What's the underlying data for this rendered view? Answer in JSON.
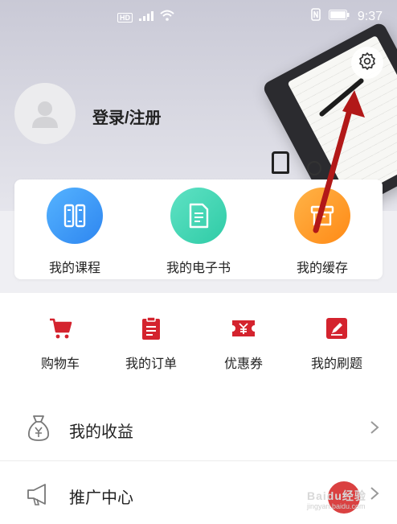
{
  "status_bar": {
    "network_badge": "HD",
    "time": "9:37",
    "icons": [
      "signal-icon",
      "wifi-icon",
      "nfc-icon",
      "battery-icon"
    ]
  },
  "profile": {
    "login_label": "登录/注册"
  },
  "card_items": [
    {
      "label": "我的课程",
      "icon": "books-icon",
      "color": "#3a96f5"
    },
    {
      "label": "我的电子书",
      "icon": "ebook-icon",
      "color": "#3dd4b1"
    },
    {
      "label": "我的缓存",
      "icon": "download-box-icon",
      "color": "#ff9a26"
    }
  ],
  "shortcuts": [
    {
      "label": "购物车",
      "icon": "cart-icon"
    },
    {
      "label": "我的订单",
      "icon": "order-icon"
    },
    {
      "label": "优惠券",
      "icon": "coupon-icon"
    },
    {
      "label": "我的刷题",
      "icon": "exercise-icon"
    }
  ],
  "list": [
    {
      "label": "我的收益",
      "icon": "money-bag-icon"
    },
    {
      "label": "推广中心",
      "icon": "megaphone-icon"
    }
  ],
  "colors": {
    "accent_red": "#d4232e",
    "annotation_arrow": "#b21818"
  },
  "watermark": {
    "brand": "Baidu经验",
    "url": "jingyan.baidu.com"
  }
}
